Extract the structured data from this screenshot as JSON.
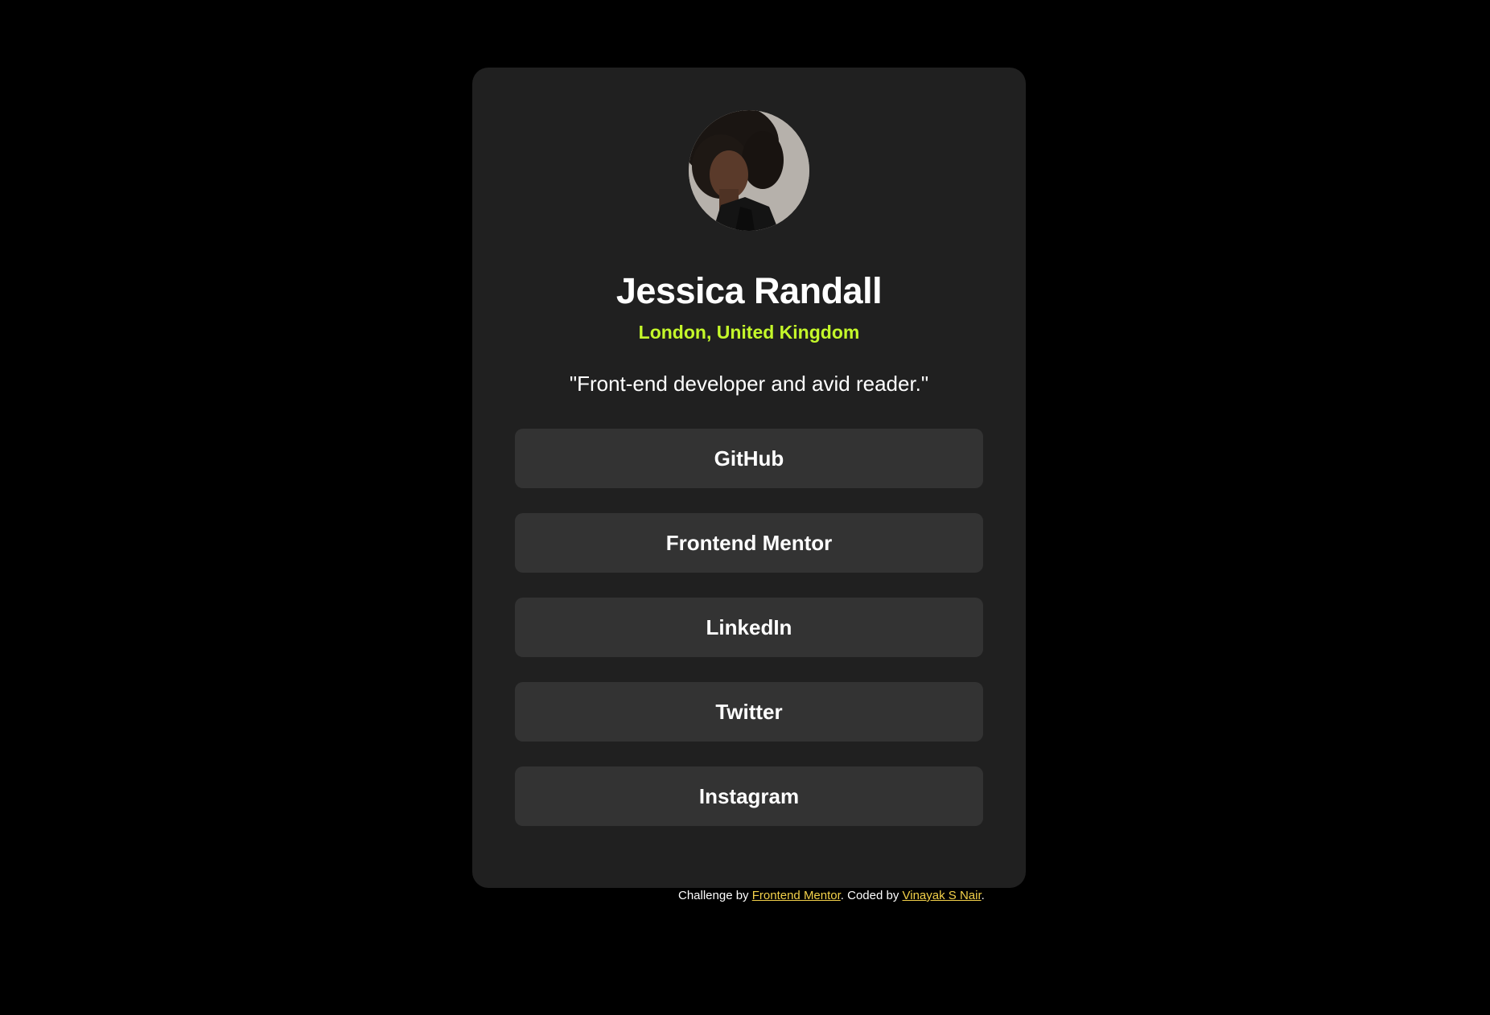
{
  "profile": {
    "name": "Jessica Randall",
    "location": "London, United Kingdom",
    "bio": "\"Front-end developer and avid reader.\""
  },
  "links": [
    {
      "label": "GitHub"
    },
    {
      "label": "Frontend Mentor"
    },
    {
      "label": "LinkedIn"
    },
    {
      "label": "Twitter"
    },
    {
      "label": "Instagram"
    }
  ],
  "footer": {
    "prefix": "Challenge by ",
    "challenge_link": "Frontend Mentor",
    "middle": ". Coded by ",
    "author_link": "Vinayak S Nair",
    "suffix": "."
  },
  "colors": {
    "background": "#000000",
    "card": "#202020",
    "button": "#333333",
    "accent_green": "#c4f82a",
    "footer_link": "#f4d24a"
  }
}
